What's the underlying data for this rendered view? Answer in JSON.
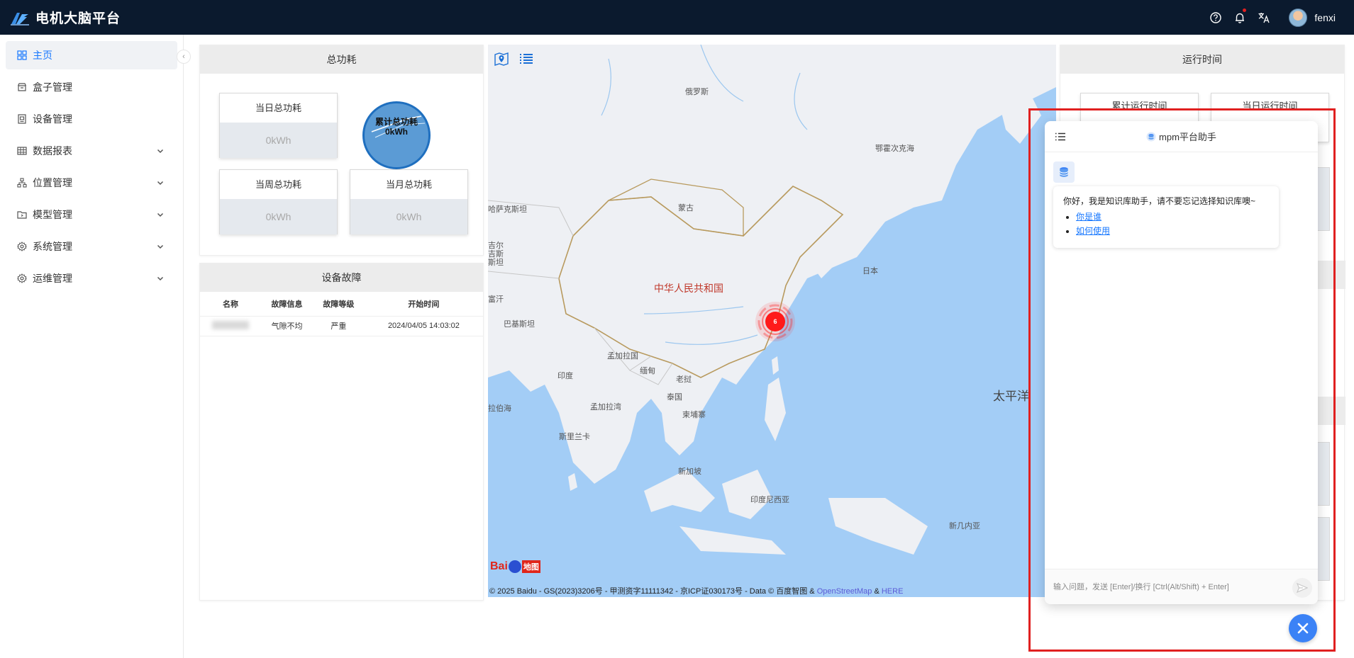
{
  "app": {
    "title": "电机大脑平台"
  },
  "header": {
    "username": "fenxi",
    "icons": [
      "help-icon",
      "bell-icon",
      "translate-icon"
    ]
  },
  "sidebar": {
    "items": [
      {
        "label": "主页",
        "icon": "dashboard-icon",
        "active": true
      },
      {
        "label": "盒子管理",
        "icon": "box-icon"
      },
      {
        "label": "设备管理",
        "icon": "device-icon"
      },
      {
        "label": "数据报表",
        "icon": "table-icon",
        "expandable": true
      },
      {
        "label": "位置管理",
        "icon": "location-tree-icon",
        "expandable": true
      },
      {
        "label": "模型管理",
        "icon": "folder-icon",
        "expandable": true
      },
      {
        "label": "系统管理",
        "icon": "gear-icon",
        "expandable": true
      },
      {
        "label": "运维管理",
        "icon": "gear-icon",
        "expandable": true
      }
    ]
  },
  "power": {
    "title": "总功耗",
    "daily": {
      "label": "当日总功耗",
      "value": "0kWh"
    },
    "cumulative": {
      "label": "累计总功耗",
      "value": "0kWh"
    },
    "weekly": {
      "label": "当周总功耗",
      "value": "0kWh"
    },
    "monthly": {
      "label": "当月总功耗",
      "value": "0kWh"
    }
  },
  "faults": {
    "title": "设备故障",
    "columns": [
      "名称",
      "故障信息",
      "故障等级",
      "开始时间"
    ],
    "rows": [
      {
        "name": "",
        "info": "气隙不均",
        "level": "严重",
        "time": "2024/04/05 14:03:02"
      }
    ]
  },
  "map": {
    "labels": {
      "russia": "俄罗斯",
      "kazakhstan": "哈萨克斯坦",
      "mongolia": "蒙古",
      "china": "中华人民共和国",
      "kyrgyzstan": "吉尔吉斯斯坦",
      "afghanistan": "富汗",
      "pakistan": "巴基斯坦",
      "bangladesh": "孟加拉国",
      "india": "印度",
      "myanmar": "缅甸",
      "laos": "老挝",
      "thailand": "泰国",
      "cambodia": "柬埔寨",
      "bay": "孟加拉湾",
      "arabian_sea": "拉伯海",
      "sri_lanka": "斯里兰卡",
      "singapore": "新加坡",
      "indonesia": "印度尼西亚",
      "png": "新几内亚",
      "japan": "日本",
      "okhotsk": "鄂霍次克海",
      "pacific": "太平洋"
    },
    "marker_count": "6",
    "logo": {
      "brand": "Bai",
      "suffix": "地图"
    },
    "copyright": {
      "text": "© 2025 Baidu - GS(2023)3206号 - 甲测资字11111342 - 京ICP证030173号 - Data © 百度智图 &",
      "osm": "OpenStreetMap",
      "amp": "&",
      "here": "HERE"
    }
  },
  "runtime": {
    "title": "运行时间",
    "cumulative_label": "累计运行时间",
    "daily_label": "当日运行时间"
  },
  "chat": {
    "title": "mpm平台助手",
    "greeting": "你好，我是知识库助手，请不要忘记选择知识库噢~",
    "links": [
      "你是谁",
      "如何使用"
    ],
    "input_placeholder": "输入问题，发送 [Enter]/换行 [Ctrl(Alt/Shift) + Enter]"
  },
  "colors": {
    "topbar": "#0b1a2e",
    "accent": "#1677ff",
    "highlight": "#e02020",
    "ocean": "#a3cdf6",
    "land": "#eef0f4",
    "marker": "#ff1a1a"
  }
}
